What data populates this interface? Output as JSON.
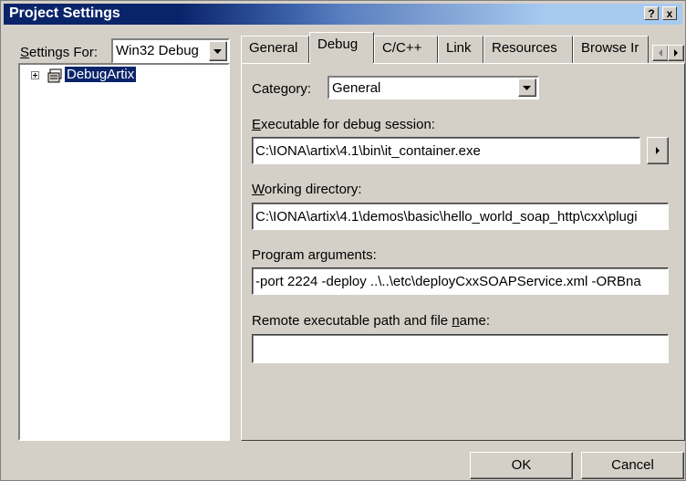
{
  "window": {
    "title": "Project Settings",
    "help_btn": "?",
    "close_btn": "x"
  },
  "left": {
    "settings_for_label": "Settings For:",
    "settings_for_value": "Win32 Debug",
    "tree_node": "DebugArtix"
  },
  "tabs": [
    {
      "label": "General"
    },
    {
      "label": "Debug"
    },
    {
      "label": "C/C++"
    },
    {
      "label": "Link"
    },
    {
      "label": "Resources"
    },
    {
      "label": "Browse Ir"
    }
  ],
  "debug": {
    "category_label": "Category:",
    "category_value": "General",
    "exe_label": "Executable for debug session:",
    "exe_value": "C:\\IONA\\artix\\4.1\\bin\\it_container.exe",
    "workdir_label": "Working directory:",
    "workdir_value": "C:\\IONA\\artix\\4.1\\demos\\basic\\hello_world_soap_http\\cxx\\plugi",
    "args_label": "Program arguments:",
    "args_value": "-port 2224 -deploy ..\\..\\etc\\deployCxxSOAPService.xml -ORBna",
    "remote_label": "Remote executable path and file name:",
    "remote_value": ""
  },
  "buttons": {
    "ok": "OK",
    "cancel": "Cancel"
  }
}
